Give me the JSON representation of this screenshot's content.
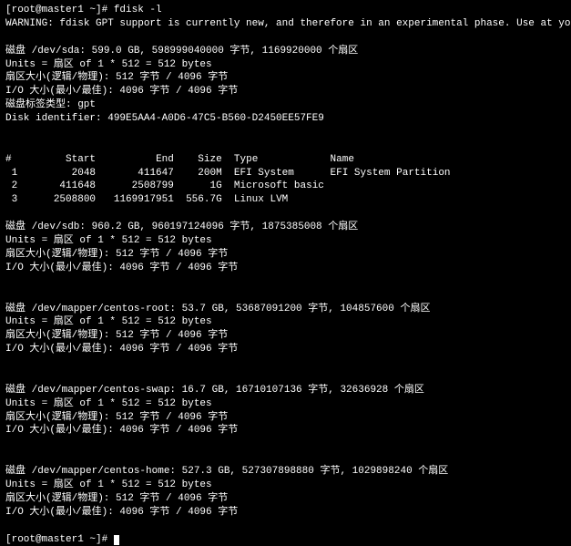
{
  "prompt1_host": "[root@master1 ~]# ",
  "cmd1": "fdisk -l",
  "warning": "WARNING: fdisk GPT support is currently new, and therefore in an experimental phase. Use at your own discretion.",
  "sda": {
    "header": "磁盘 /dev/sda: 599.0 GB, 598999040000 字节, 1169920000 个扇区",
    "units": "Units = 扇区 of 1 * 512 = 512 bytes",
    "sector": "扇区大小(逻辑/物理): 512 字节 / 4096 字节",
    "io": "I/O 大小(最小/最佳): 4096 字节 / 4096 字节",
    "label": "磁盘标签类型: gpt",
    "ident": "Disk identifier: 499E5AA4-A0D6-47C5-B560-D2450EE57FE9"
  },
  "part_header": {
    "num": "#",
    "start": "Start",
    "end": "End",
    "size": "Size",
    "type": "Type",
    "name": "Name"
  },
  "parts": [
    {
      "num": " 1",
      "start": "2048",
      "end": "411647",
      "size": "200M",
      "type": "EFI System",
      "name": "EFI System Partition"
    },
    {
      "num": " 2",
      "start": "411648",
      "end": "2508799",
      "size": "1G",
      "type": "Microsoft basic",
      "name": ""
    },
    {
      "num": " 3",
      "start": "2508800",
      "end": "1169917951",
      "size": "556.7G",
      "type": "Linux LVM",
      "name": ""
    }
  ],
  "sdb": {
    "header": "磁盘 /dev/sdb: 960.2 GB, 960197124096 字节, 1875385008 个扇区",
    "units": "Units = 扇区 of 1 * 512 = 512 bytes",
    "sector": "扇区大小(逻辑/物理): 512 字节 / 4096 字节",
    "io": "I/O 大小(最小/最佳): 4096 字节 / 4096 字节"
  },
  "root": {
    "header": "磁盘 /dev/mapper/centos-root: 53.7 GB, 53687091200 字节, 104857600 个扇区",
    "units": "Units = 扇区 of 1 * 512 = 512 bytes",
    "sector": "扇区大小(逻辑/物理): 512 字节 / 4096 字节",
    "io": "I/O 大小(最小/最佳): 4096 字节 / 4096 字节"
  },
  "swap": {
    "header": "磁盘 /dev/mapper/centos-swap: 16.7 GB, 16710107136 字节, 32636928 个扇区",
    "units": "Units = 扇区 of 1 * 512 = 512 bytes",
    "sector": "扇区大小(逻辑/物理): 512 字节 / 4096 字节",
    "io": "I/O 大小(最小/最佳): 4096 字节 / 4096 字节"
  },
  "home": {
    "header": "磁盘 /dev/mapper/centos-home: 527.3 GB, 527307898880 字节, 1029898240 个扇区",
    "units": "Units = 扇区 of 1 * 512 = 512 bytes",
    "sector": "扇区大小(逻辑/物理): 512 字节 / 4096 字节",
    "io": "I/O 大小(最小/最佳): 4096 字节 / 4096 字节"
  },
  "prompt2_host": "[root@master1 ~]# "
}
